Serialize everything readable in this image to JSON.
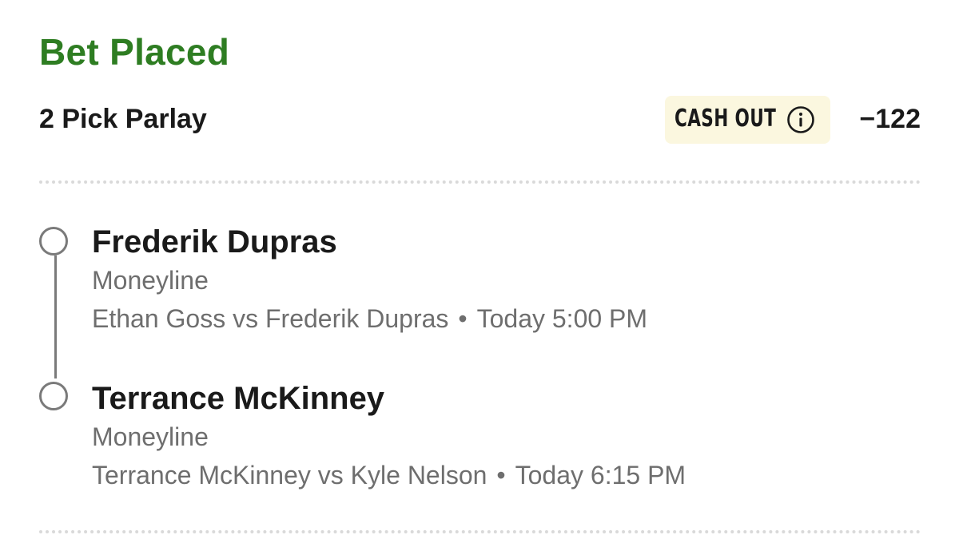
{
  "header": {
    "status": "Bet Placed",
    "bet_type": "2 Pick Parlay",
    "cash_out_label": "CASH OUT",
    "cash_out_icon": "info-icon",
    "odds": "−122"
  },
  "legs": [
    {
      "selection": "Frederik Dupras",
      "market": "Moneyline",
      "matchup": "Ethan Goss vs Frederik Dupras",
      "separator": "•",
      "time": "Today 5:00 PM"
    },
    {
      "selection": "Terrance McKinney",
      "market": "Moneyline",
      "matchup": "Terrance McKinney vs Kyle Nelson",
      "separator": "•",
      "time": "Today 6:15 PM"
    }
  ],
  "colors": {
    "status_green": "#2e7d22",
    "cash_out_bg": "#fbf7df",
    "secondary_text": "#6e6e6e",
    "timeline": "#7a7a7a"
  }
}
